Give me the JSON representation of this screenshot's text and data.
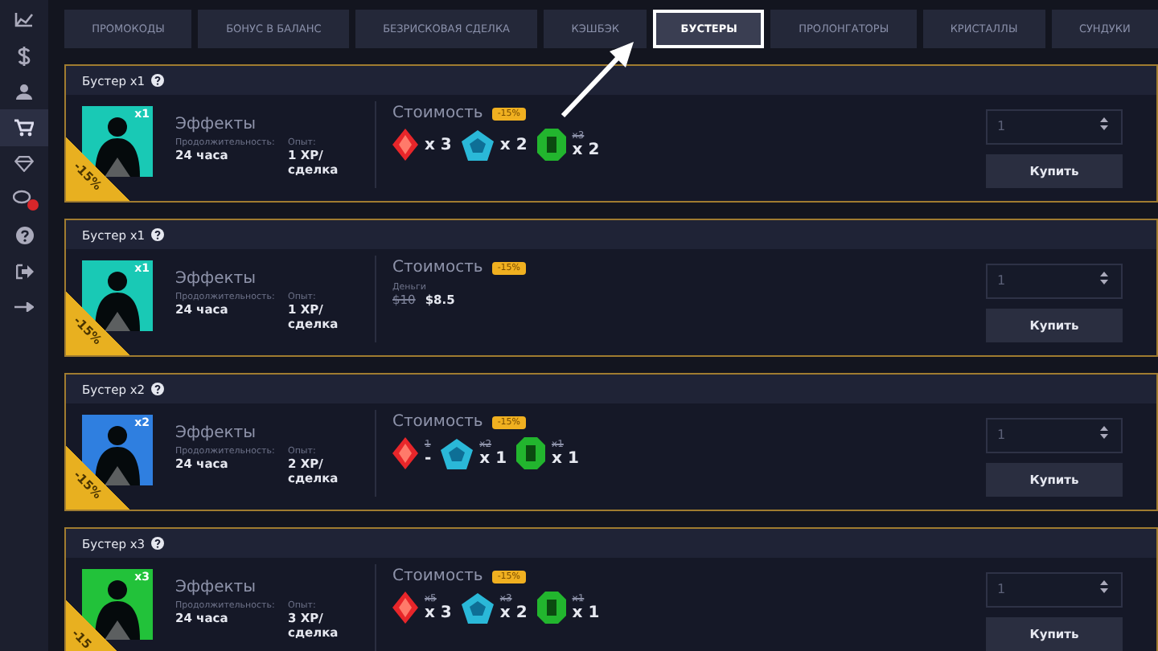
{
  "sidebar": {
    "items": [
      {
        "kind": "chart",
        "selected": false,
        "notification": false
      },
      {
        "kind": "dollar",
        "selected": false,
        "notification": false
      },
      {
        "kind": "user",
        "selected": false,
        "notification": false
      },
      {
        "kind": "cart",
        "selected": true,
        "notification": false
      },
      {
        "kind": "diamond",
        "selected": false,
        "notification": false
      },
      {
        "kind": "chat",
        "selected": false,
        "notification": true
      },
      {
        "kind": "help",
        "selected": false,
        "notification": false
      },
      {
        "kind": "exit",
        "selected": false,
        "notification": false
      },
      {
        "kind": "arrow",
        "selected": false,
        "notification": false
      }
    ]
  },
  "tabs": [
    {
      "label": "ПРОМОКОДЫ",
      "selected": false
    },
    {
      "label": "БОНУС В БАЛАНС",
      "selected": false
    },
    {
      "label": "БЕЗРИСКОВАЯ СДЕЛКА",
      "selected": false
    },
    {
      "label": "КЭШБЭК",
      "selected": false
    },
    {
      "label": "БУСТЕРЫ",
      "selected": true
    },
    {
      "label": "ПРОЛОНГАТОРЫ",
      "selected": false
    },
    {
      "label": "КРИСТАЛЛЫ",
      "selected": false
    },
    {
      "label": "СУНДУКИ",
      "selected": false
    }
  ],
  "boosters": [
    {
      "title": "Бустер x1",
      "multiplier": "x1",
      "color": "#19c9b5",
      "ribbon": "-15%",
      "effects_label": "Эффекты",
      "duration_label": "Продолжительность:",
      "duration": "24 часа",
      "xp_label": "Опыт:",
      "xp": "1 XP/ сделка",
      "cost_label": "Стоимость",
      "cost_badge": "-15%",
      "cost": {
        "kind": "gems",
        "items": [
          {
            "kind": "red",
            "count": "x 3"
          },
          {
            "kind": "blue",
            "count": "x 2"
          },
          {
            "kind": "green",
            "old": "x3",
            "count": "x 2"
          }
        ]
      },
      "quantity": "1",
      "button": "Купить"
    },
    {
      "title": "Бустер x1",
      "multiplier": "x1",
      "color": "#19c9b5",
      "ribbon": "-15%",
      "effects_label": "Эффекты",
      "duration_label": "Продолжительность:",
      "duration": "24 часа",
      "xp_label": "Опыт:",
      "xp": "1 XP/ сделка",
      "cost_label": "Стоимость",
      "cost_badge": "-15%",
      "cost": {
        "kind": "money",
        "label": "Деньги",
        "old": "$10",
        "price": "$8.5"
      },
      "quantity": "1",
      "button": "Купить"
    },
    {
      "title": "Бустер x2",
      "multiplier": "x2",
      "color": "#2f7fe0",
      "ribbon": "-15%",
      "effects_label": "Эффекты",
      "duration_label": "Продолжительность:",
      "duration": "24 часа",
      "xp_label": "Опыт:",
      "xp": "2 XP/ сделка",
      "cost_label": "Стоимость",
      "cost_badge": "-15%",
      "cost": {
        "kind": "gems",
        "items": [
          {
            "kind": "red",
            "old": "1",
            "count": "-"
          },
          {
            "kind": "blue",
            "old": "x2",
            "count": "x 1"
          },
          {
            "kind": "green",
            "old": "x1",
            "count": "x 1"
          }
        ]
      },
      "quantity": "1",
      "button": "Купить"
    },
    {
      "title": "Бустер x3",
      "multiplier": "x3",
      "color": "#22c23a",
      "ribbon": "-15",
      "effects_label": "Эффекты",
      "duration_label": "Продолжительность:",
      "duration": "24 часа",
      "xp_label": "Опыт:",
      "xp": "3 XP/ сделка",
      "cost_label": "Стоимость",
      "cost_badge": "-15%",
      "cost": {
        "kind": "gems",
        "items": [
          {
            "kind": "red",
            "old": "x5",
            "count": "x 3"
          },
          {
            "kind": "blue",
            "old": "x3",
            "count": "x 2"
          },
          {
            "kind": "green",
            "old": "x1",
            "count": "x 1"
          }
        ]
      },
      "quantity": "1",
      "button": "Купить"
    }
  ]
}
